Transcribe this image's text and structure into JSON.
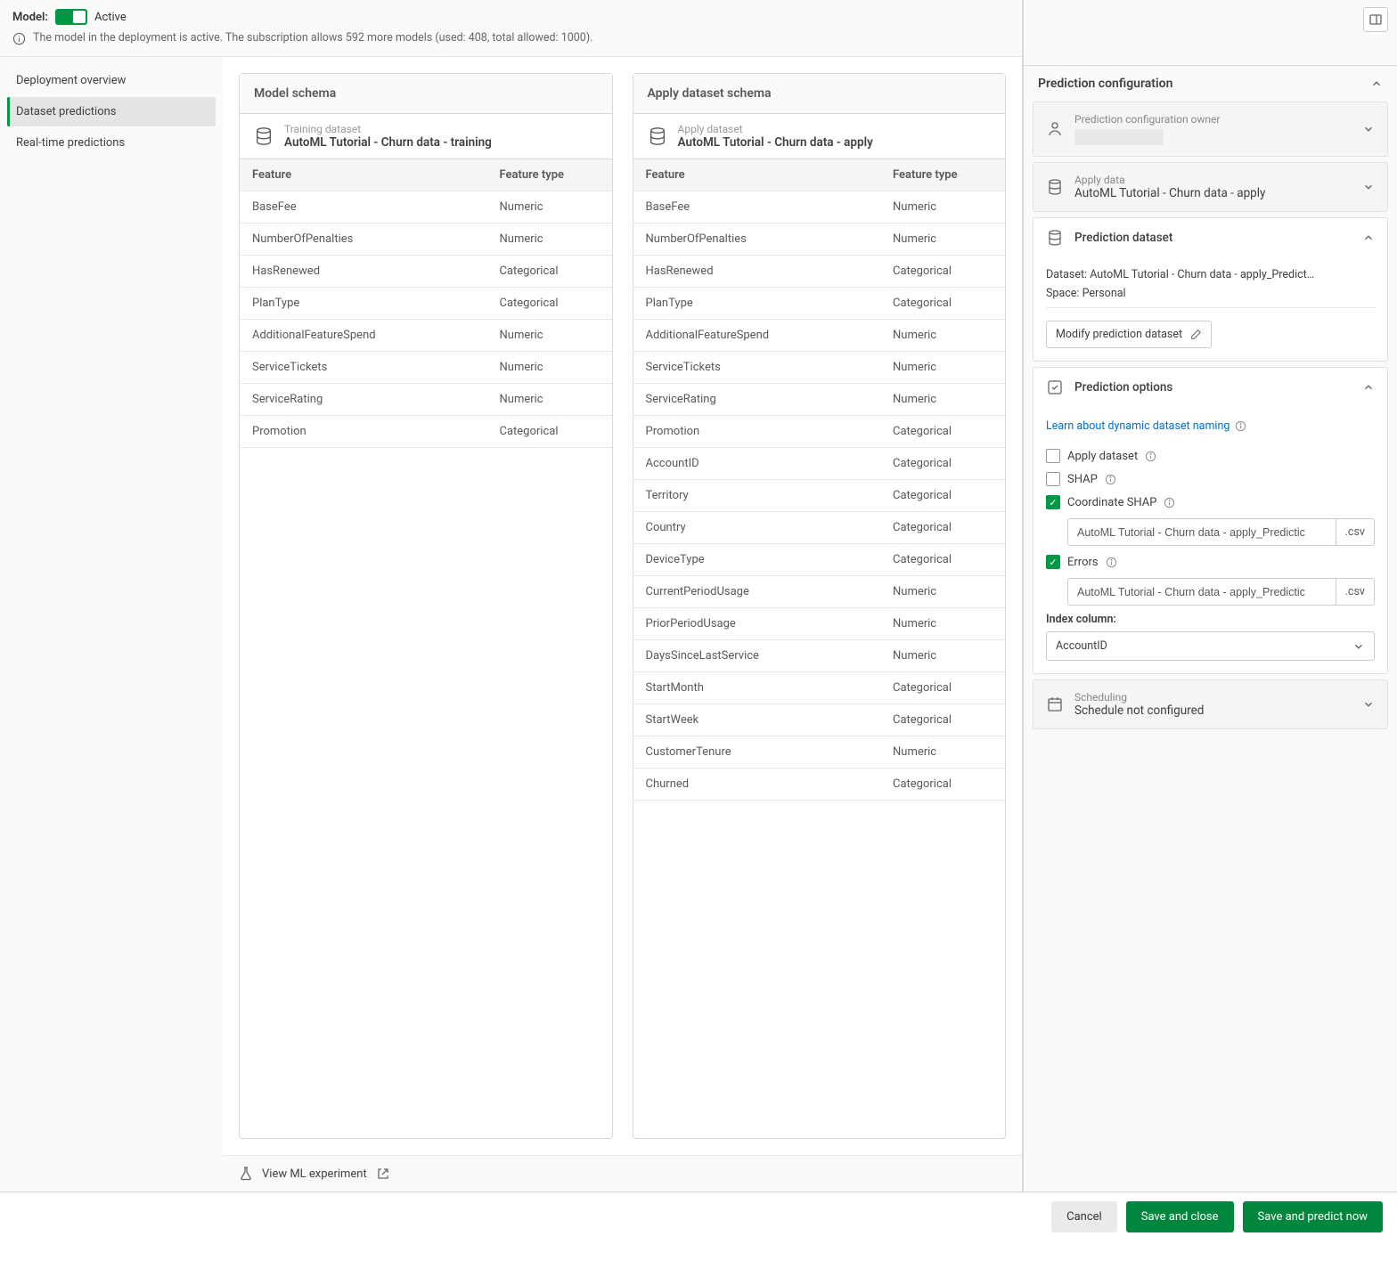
{
  "header": {
    "model_label": "Model:",
    "status": "Active",
    "info_text": "The model in the deployment is active. The subscription allows 592 more models (used: 408, total allowed: 1000)."
  },
  "sidebar": {
    "items": [
      {
        "label": "Deployment overview"
      },
      {
        "label": "Dataset predictions"
      },
      {
        "label": "Real-time predictions"
      }
    ]
  },
  "model_schema": {
    "title": "Model schema",
    "ds_label": "Training dataset",
    "ds_name": "AutoML Tutorial - Churn data - training",
    "col_feature": "Feature",
    "col_type": "Feature type",
    "rows": [
      {
        "f": "BaseFee",
        "t": "Numeric"
      },
      {
        "f": "NumberOfPenalties",
        "t": "Numeric"
      },
      {
        "f": "HasRenewed",
        "t": "Categorical"
      },
      {
        "f": "PlanType",
        "t": "Categorical"
      },
      {
        "f": "AdditionalFeatureSpend",
        "t": "Numeric"
      },
      {
        "f": "ServiceTickets",
        "t": "Numeric"
      },
      {
        "f": "ServiceRating",
        "t": "Numeric"
      },
      {
        "f": "Promotion",
        "t": "Categorical"
      }
    ]
  },
  "apply_schema": {
    "title": "Apply dataset schema",
    "ds_label": "Apply dataset",
    "ds_name": "AutoML Tutorial - Churn data - apply",
    "col_feature": "Feature",
    "col_type": "Feature type",
    "rows": [
      {
        "f": "BaseFee",
        "t": "Numeric"
      },
      {
        "f": "NumberOfPenalties",
        "t": "Numeric"
      },
      {
        "f": "HasRenewed",
        "t": "Categorical"
      },
      {
        "f": "PlanType",
        "t": "Categorical"
      },
      {
        "f": "AdditionalFeatureSpend",
        "t": "Numeric"
      },
      {
        "f": "ServiceTickets",
        "t": "Numeric"
      },
      {
        "f": "ServiceRating",
        "t": "Numeric"
      },
      {
        "f": "Promotion",
        "t": "Categorical"
      },
      {
        "f": "AccountID",
        "t": "Categorical"
      },
      {
        "f": "Territory",
        "t": "Categorical"
      },
      {
        "f": "Country",
        "t": "Categorical"
      },
      {
        "f": "DeviceType",
        "t": "Categorical"
      },
      {
        "f": "CurrentPeriodUsage",
        "t": "Numeric"
      },
      {
        "f": "PriorPeriodUsage",
        "t": "Numeric"
      },
      {
        "f": "DaysSinceLastService",
        "t": "Numeric"
      },
      {
        "f": "StartMonth",
        "t": "Categorical"
      },
      {
        "f": "StartWeek",
        "t": "Categorical"
      },
      {
        "f": "CustomerTenure",
        "t": "Numeric"
      },
      {
        "f": "Churned",
        "t": "Categorical"
      }
    ]
  },
  "bottom_link": "View ML experiment",
  "right": {
    "title": "Prediction configuration",
    "owner_label": "Prediction configuration owner",
    "apply_data_label": "Apply data",
    "apply_data_value": "AutoML Tutorial - Churn data - apply",
    "pred_dataset_label": "Prediction dataset",
    "dataset_key": "Dataset:",
    "dataset_val": "AutoML Tutorial - Churn data - apply_Predict…",
    "space_key": "Space:",
    "space_val": "Personal",
    "modify_btn": "Modify prediction dataset",
    "options_label": "Prediction options",
    "learn_link": "Learn about dynamic dataset naming",
    "apply_dataset_opt": "Apply dataset",
    "shap_opt": "SHAP",
    "coord_shap_opt": "Coordinate SHAP",
    "coord_shap_file": "AutoML Tutorial - Churn data - apply_Predictic",
    "errors_opt": "Errors",
    "errors_file": "AutoML Tutorial - Churn data - apply_Predictic",
    "file_ext": ".csv",
    "index_label": "Index column:",
    "index_value": "AccountID",
    "scheduling_label": "Scheduling",
    "scheduling_value": "Schedule not configured"
  },
  "footer": {
    "cancel": "Cancel",
    "save_close": "Save and close",
    "save_predict": "Save and predict now"
  }
}
